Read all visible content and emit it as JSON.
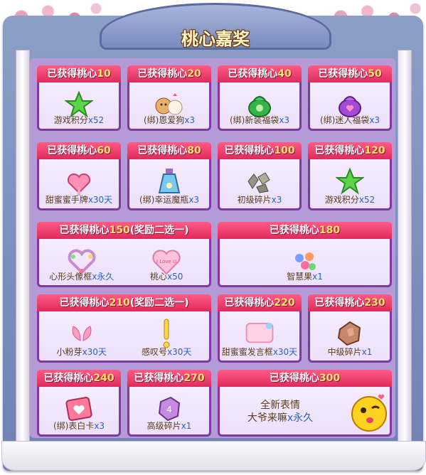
{
  "title": "桃心嘉奖",
  "rewards": [
    {
      "prefix": "已获得桃心",
      "num": "10",
      "suffix": "",
      "item": "游戏积分",
      "count": "x52",
      "icon": "green-star-icon"
    },
    {
      "prefix": "已获得桃心",
      "num": "20",
      "suffix": "",
      "item": "(绑)恩爱狗",
      "count": "x3",
      "icon": "dog-pair-icon"
    },
    {
      "prefix": "已获得桃心",
      "num": "40",
      "suffix": "",
      "item": "(绑)新装福袋",
      "count": "x3",
      "icon": "green-bag-icon"
    },
    {
      "prefix": "已获得桃心",
      "num": "50",
      "suffix": "",
      "item": "(绑)迷人福袋",
      "count": "x3",
      "icon": "purple-bag-icon"
    },
    {
      "prefix": "已获得桃心",
      "num": "60",
      "suffix": "",
      "item": "甜蜜蜜手牌",
      "count": "x30天",
      "icon": "pink-heart-sign-icon"
    },
    {
      "prefix": "已获得桃心",
      "num": "80",
      "suffix": "",
      "item": "(绑)幸运魔瓶",
      "count": "x3",
      "icon": "magic-bottle-icon"
    },
    {
      "prefix": "已获得桃心",
      "num": "100",
      "suffix": "",
      "item": "初级碎片",
      "count": "x3",
      "icon": "stone-shards-icon"
    },
    {
      "prefix": "已获得桃心",
      "num": "120",
      "suffix": "",
      "item": "游戏积分",
      "count": "x52",
      "icon": "green-star-icon"
    },
    {
      "prefix": "已获得桃心",
      "num": "150",
      "suffix": "(奖励二选一)",
      "itemA": "心形头像框",
      "countA": "x永久",
      "iconA": "heart-frame-icon",
      "itemB": "桃心",
      "countB": "x50",
      "iconB": "i-love-u-heart-icon"
    },
    {
      "prefix": "已获得桃心",
      "num": "180",
      "suffix": "",
      "item": "智慧果",
      "count": "x1",
      "icon": "wisdom-fruit-icon"
    },
    {
      "prefix": "已获得桃心",
      "num": "210",
      "suffix": "(奖励二选一)",
      "itemA": "小粉芽",
      "countA": "x30天",
      "iconA": "pink-sprout-icon",
      "itemB": "感叹号",
      "countB": "x30天",
      "iconB": "exclamation-icon"
    },
    {
      "prefix": "已获得桃心",
      "num": "220",
      "suffix": "",
      "item": "甜蜜蜜发言框",
      "count": "x30天",
      "icon": "speech-frame-icon"
    },
    {
      "prefix": "已获得桃心",
      "num": "230",
      "suffix": "",
      "item": "中级碎片",
      "count": "x1",
      "icon": "mid-shard-icon"
    },
    {
      "prefix": "已获得桃心",
      "num": "240",
      "suffix": "",
      "item": "(绑)表白卡",
      "count": "x3",
      "icon": "love-card-icon"
    },
    {
      "prefix": "已获得桃心",
      "num": "270",
      "suffix": "",
      "item": "高级碎片",
      "count": "x1",
      "icon": "high-shard-icon"
    },
    {
      "prefix": "已获得桃心",
      "num": "300",
      "suffix": "",
      "line1": "全新表情",
      "line2": "大爷来嘛",
      "count": "x永久",
      "icon": "kiss-emoji-icon"
    }
  ]
}
